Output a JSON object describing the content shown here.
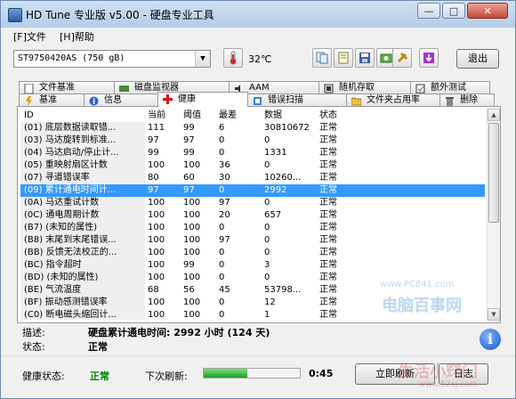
{
  "window": {
    "title": "HD Tune 专业版 v5.00 - 硬盘专业工具",
    "min": "—",
    "max": "□",
    "close": "✕"
  },
  "menu": {
    "file": "[F]文件",
    "help": "[H]帮助"
  },
  "toolbar": {
    "drive": "ST9750420AS (750 gB)",
    "temperature": "32℃",
    "exit_label": "退出"
  },
  "tabs": {
    "row1": [
      {
        "label": "文件基准",
        "icon": "file-benchmark-icon"
      },
      {
        "label": "磁盘监视器",
        "icon": "disk-monitor-icon"
      },
      {
        "label": "AAM",
        "icon": "speaker-icon"
      },
      {
        "label": "随机存取",
        "icon": "random-access-icon"
      },
      {
        "label": "额外测试",
        "icon": "extra-tests-icon"
      }
    ],
    "row2": [
      {
        "label": "基准",
        "icon": "benchmark-icon"
      },
      {
        "label": "信息",
        "icon": "info-tab-icon"
      },
      {
        "label": "健康",
        "icon": "health-cross-icon"
      },
      {
        "label": "错误扫描",
        "icon": "error-scan-icon"
      },
      {
        "label": "文件夹占用率",
        "icon": "folder-icon"
      },
      {
        "label": "删除",
        "icon": "delete-icon"
      }
    ]
  },
  "table": {
    "headers": {
      "id": "ID",
      "current": "当前",
      "threshold": "阈值",
      "worst": "最差",
      "data": "数据",
      "status": "状态"
    },
    "rows": [
      {
        "id": "(01) 底层数据读取错...",
        "current": "111",
        "threshold": "99",
        "worst": "6",
        "data": "30810672",
        "status": "正常"
      },
      {
        "id": "(03) 马达旋转到标准...",
        "current": "97",
        "threshold": "97",
        "worst": "0",
        "data": "0",
        "status": "正常"
      },
      {
        "id": "(04) 马达启动/停止计...",
        "current": "99",
        "threshold": "99",
        "worst": "0",
        "data": "1331",
        "status": "正常"
      },
      {
        "id": "(05) 重映射扇区计数",
        "current": "100",
        "threshold": "100",
        "worst": "36",
        "data": "0",
        "status": "正常"
      },
      {
        "id": "(07) 寻道错误率",
        "current": "80",
        "threshold": "60",
        "worst": "30",
        "data": "10260...",
        "status": "正常"
      },
      {
        "id": "(09) 累计通电时间计...",
        "current": "97",
        "threshold": "97",
        "worst": "0",
        "data": "2992",
        "status": "正常"
      },
      {
        "id": "(0A) 马达重试计数",
        "current": "100",
        "threshold": "100",
        "worst": "97",
        "data": "0",
        "status": "正常"
      },
      {
        "id": "(0C) 通电周期计数",
        "current": "100",
        "threshold": "100",
        "worst": "20",
        "data": "657",
        "status": "正常"
      },
      {
        "id": "(B7) (未知的属性)",
        "current": "100",
        "threshold": "100",
        "worst": "0",
        "data": "0",
        "status": "正常"
      },
      {
        "id": "(B8) 末尾到末尾错误...",
        "current": "100",
        "threshold": "100",
        "worst": "97",
        "data": "0",
        "status": "正常"
      },
      {
        "id": "(BB) 反馈无法校正的...",
        "current": "100",
        "threshold": "100",
        "worst": "0",
        "data": "0",
        "status": "正常"
      },
      {
        "id": "(BC) 指令超时",
        "current": "100",
        "threshold": "99",
        "worst": "0",
        "data": "3",
        "status": "正常"
      },
      {
        "id": "(BD) (未知的属性)",
        "current": "100",
        "threshold": "100",
        "worst": "0",
        "data": "0",
        "status": "正常"
      },
      {
        "id": "(BE) 气流温度",
        "current": "68",
        "threshold": "56",
        "worst": "45",
        "data": "53798...",
        "status": "正常"
      },
      {
        "id": "(BF) 振动感测错误率",
        "current": "100",
        "threshold": "100",
        "worst": "0",
        "data": "12",
        "status": "正常"
      },
      {
        "id": "(C0) 断电磁头缩回计...",
        "current": "100",
        "threshold": "100",
        "worst": "0",
        "data": "1",
        "status": "正常"
      }
    ],
    "selected_index": 5
  },
  "description": {
    "desc_label": "描述:",
    "desc_value": "硬盘累计通电时间: 2992 小时 (124 天)",
    "status_label": "状态:",
    "status_value": "正常"
  },
  "bottom": {
    "health_label": "健康状态:",
    "health_value": "正常",
    "next_refresh_label": "下次刷新:",
    "progress": 0.45,
    "countdown": "0:45",
    "refresh_button": "立即刷新",
    "log_button": "日志"
  },
  "watermarks": {
    "site1": "www.PC841.com",
    "site2": "电脑百事网",
    "site3": "生活小窍门",
    "site4": "www.52xj.com"
  },
  "colors": {
    "selected_row": "#3399ff",
    "ok_status": "#008000",
    "progress_fill": "#1f9e23"
  }
}
